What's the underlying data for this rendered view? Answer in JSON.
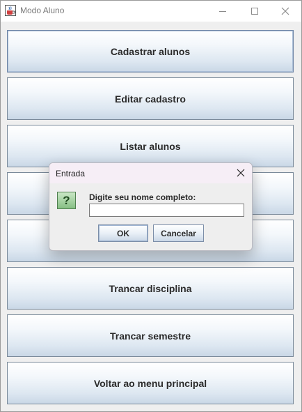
{
  "window": {
    "title": "Modo Aluno",
    "app_icon": "java-cup-icon",
    "controls": {
      "minimize": "minimize-icon",
      "maximize": "maximize-icon",
      "close": "close-icon"
    }
  },
  "menu": {
    "buttons": [
      {
        "label": "Cadastrar alunos"
      },
      {
        "label": "Editar cadastro"
      },
      {
        "label": "Listar alunos"
      },
      {
        "label": ""
      },
      {
        "label": ""
      },
      {
        "label": "Trancar disciplina"
      },
      {
        "label": "Trancar semestre"
      },
      {
        "label": "Voltar ao menu principal"
      }
    ]
  },
  "dialog": {
    "title": "Entrada",
    "icon": "question-icon",
    "icon_glyph": "?",
    "prompt": "Digite seu nome completo:",
    "input_value": "",
    "ok_label": "OK",
    "cancel_label": "Cancelar"
  }
}
